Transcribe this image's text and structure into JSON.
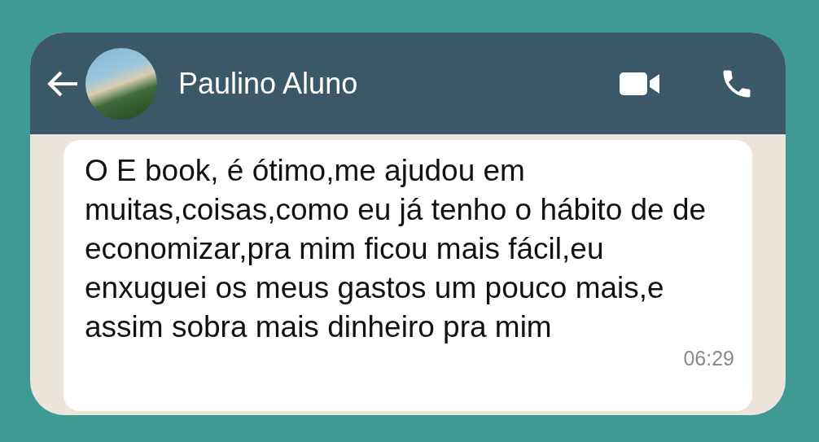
{
  "header": {
    "contact_name": "Paulino Aluno"
  },
  "message": {
    "text": "O E book, é ótimo,me ajudou em muitas,coisas,como eu já tenho o hábito de de economizar,pra mim ficou mais fácil,eu enxuguei os meus gastos um pouco mais,e assim sobra mais dinheiro pra mim",
    "time": "06:29"
  }
}
